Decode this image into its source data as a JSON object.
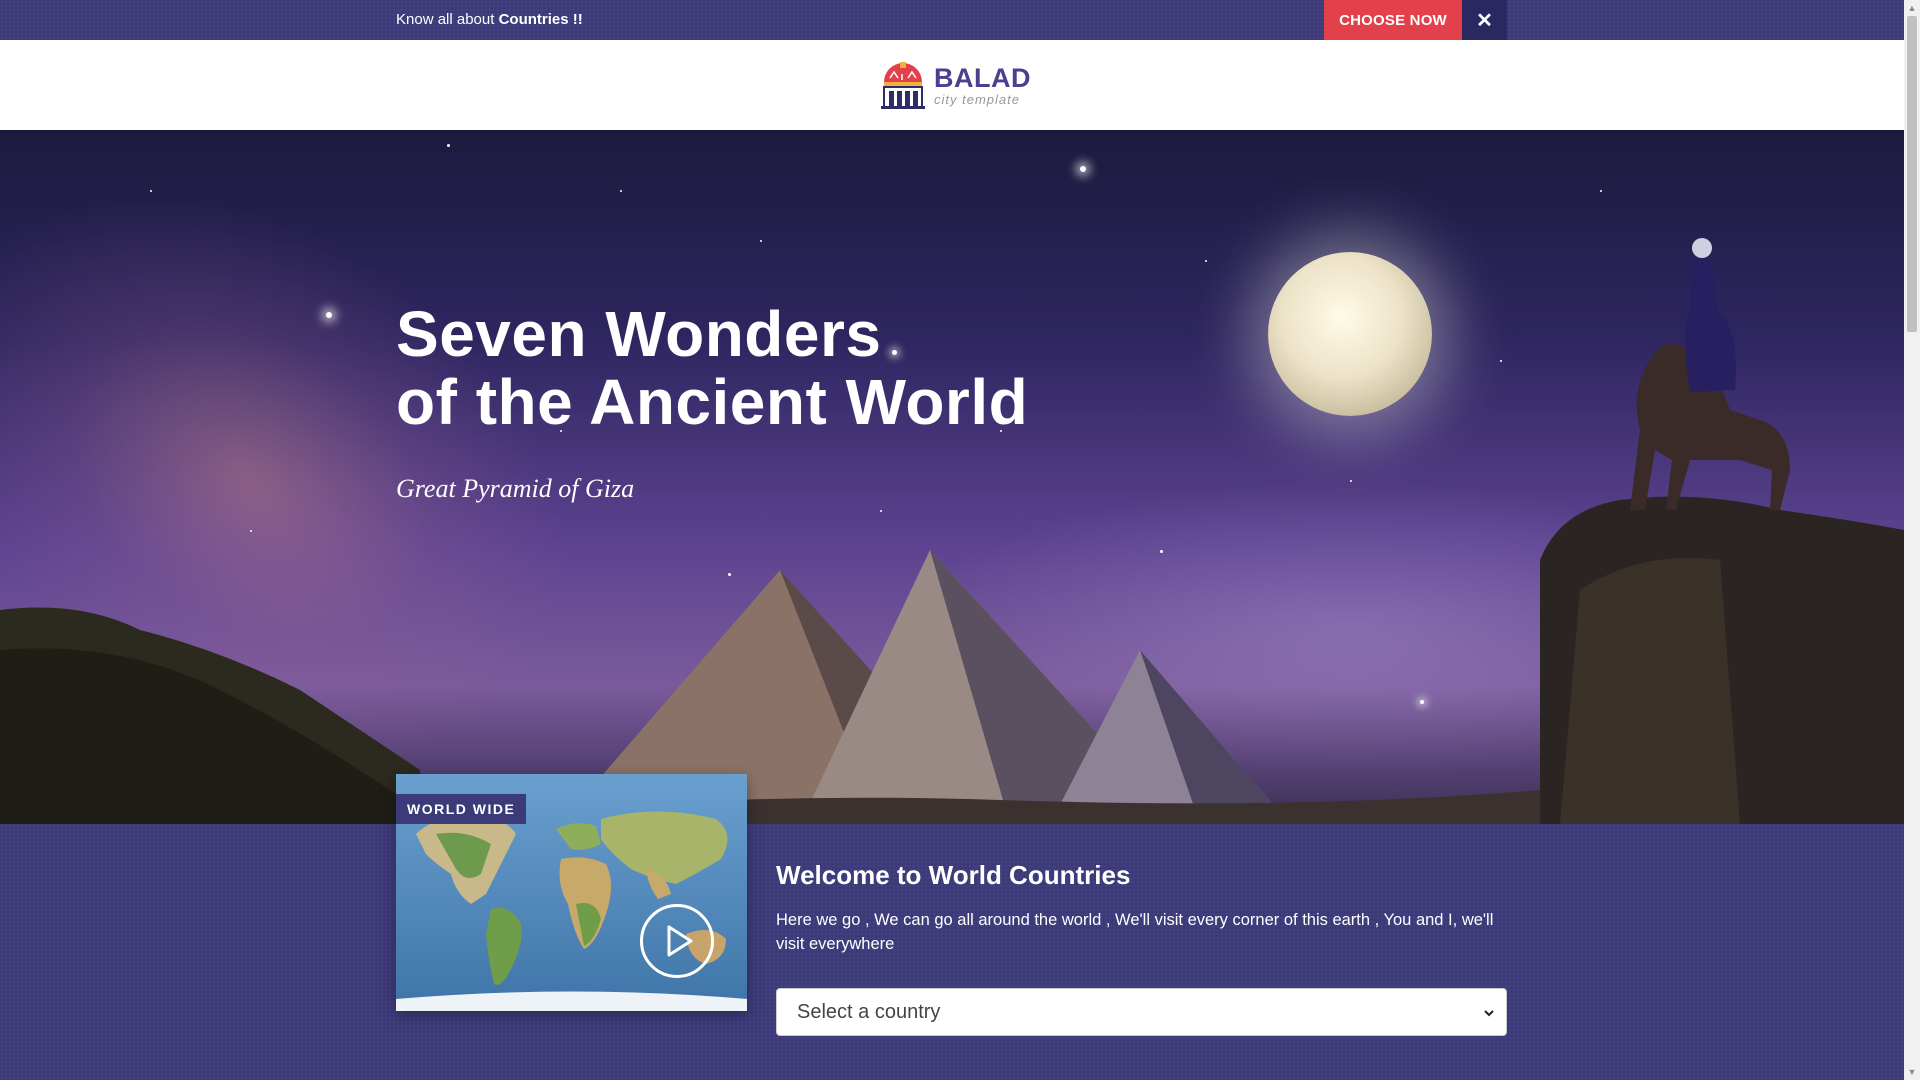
{
  "topbar": {
    "text_prefix": "Know all about ",
    "text_bold": "Countries !!",
    "choose_label": "CHOOSE NOW",
    "close_symbol": "✕",
    "accent_color": "#e2404a"
  },
  "header": {
    "logo_name": "BALAD",
    "logo_sub": "city template"
  },
  "hero": {
    "title_line1": "Seven Wonders",
    "title_line2": "of the Ancient World",
    "subtitle": "Great Pyramid of Giza"
  },
  "section": {
    "map_badge": "WORLD WIDE",
    "welcome_title": "Welcome to World Countries",
    "welcome_text": "Here we go , We can go all around the world , We'll visit every corner of this earth , You and I, we'll visit everywhere",
    "select_placeholder": "Select a country",
    "brand_color": "#3d3a7a"
  },
  "icons": {
    "play": "play-icon",
    "close": "close-icon",
    "chevron": "chevron-down-icon"
  }
}
